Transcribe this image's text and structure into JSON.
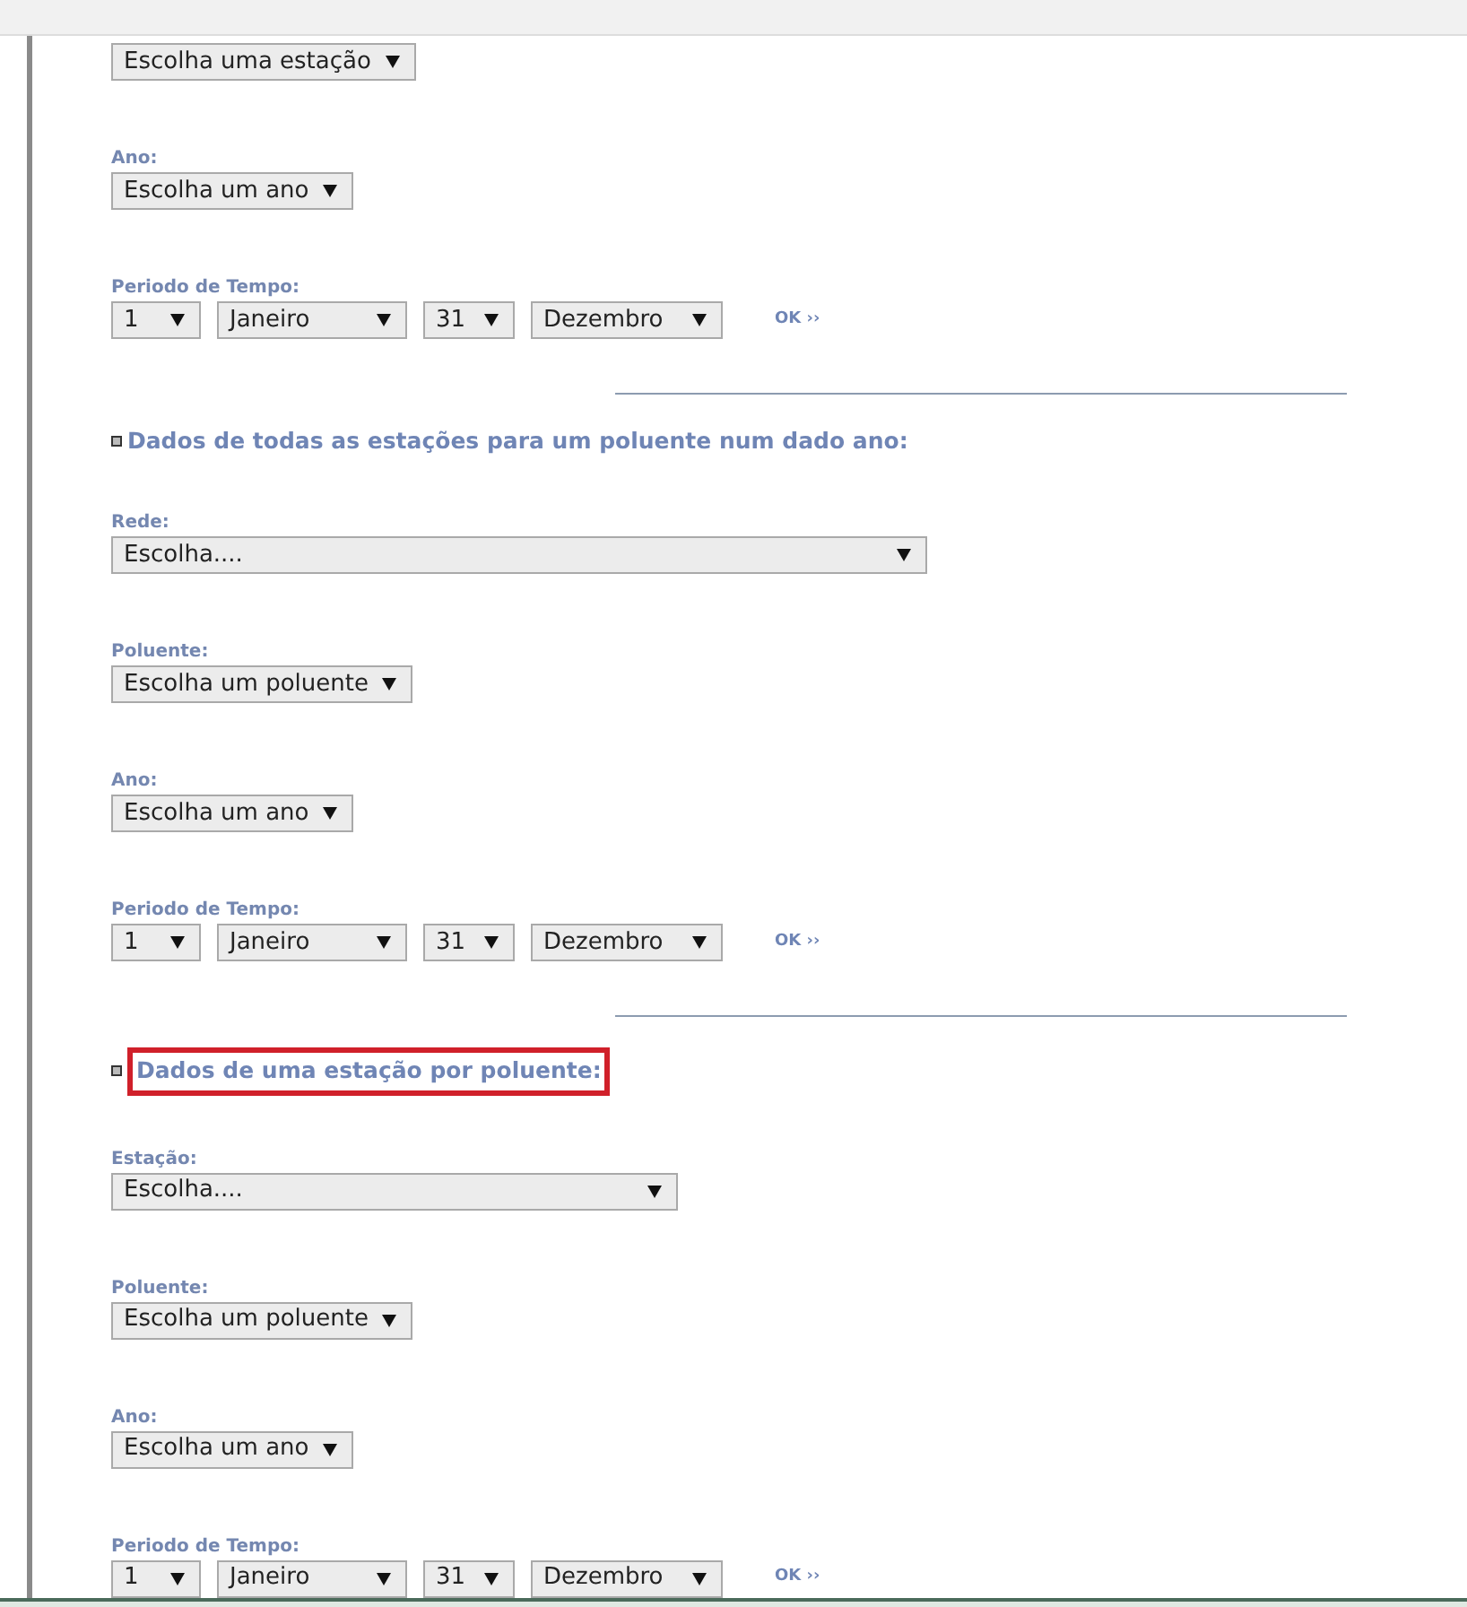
{
  "sections": [
    {
      "fields": [
        {
          "value": "Escolha uma estação"
        },
        {
          "label": "Ano:",
          "value": "Escolha um ano"
        }
      ],
      "period": {
        "label": "Periodo de Tempo:",
        "selects": [
          "1",
          "Janeiro",
          "31",
          "Dezembro"
        ],
        "ok": "OK ››"
      }
    },
    {
      "heading": "Dados de todas as estações para um poluente num dado ano:",
      "highlighted": false,
      "fields": [
        {
          "label": "Rede:",
          "value": "Escolha....",
          "kind": "wide"
        },
        {
          "label": "Poluente:",
          "value": "Escolha um poluente"
        },
        {
          "label": "Ano:",
          "value": "Escolha um ano"
        }
      ],
      "period": {
        "label": "Periodo de Tempo:",
        "selects": [
          "1",
          "Janeiro",
          "31",
          "Dezembro"
        ],
        "ok": "OK ››"
      }
    },
    {
      "heading": "Dados de uma estação por poluente:",
      "highlighted": true,
      "fields": [
        {
          "label": "Estação:",
          "value": "Escolha....",
          "kind": "medium"
        },
        {
          "label": "Poluente:",
          "value": "Escolha um poluente"
        },
        {
          "label": "Ano:",
          "value": "Escolha um ano"
        }
      ],
      "period": {
        "label": "Periodo de Tempo:",
        "selects": [
          "1",
          "Janeiro",
          "31",
          "Dezembro"
        ],
        "ok": "OK ››"
      }
    }
  ]
}
